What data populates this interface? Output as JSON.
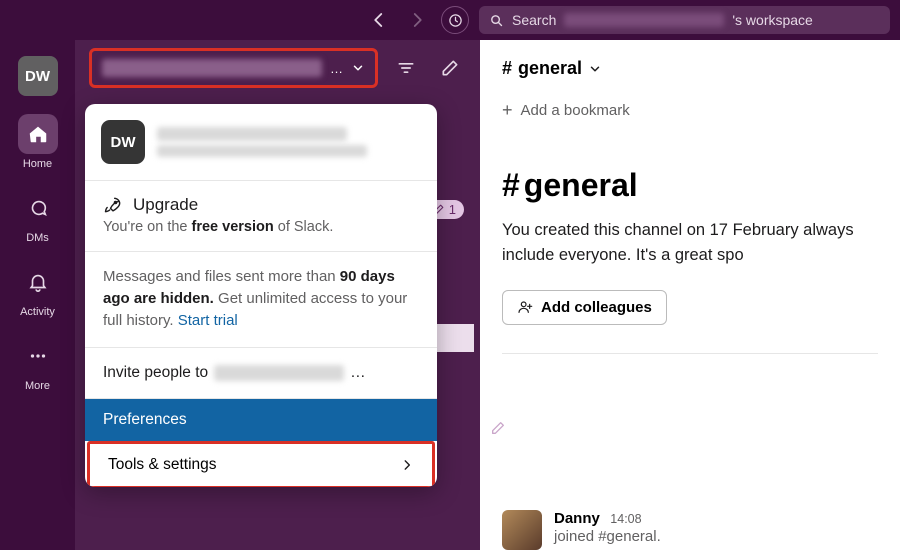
{
  "workspace_initials": "DW",
  "search": {
    "label_prefix": "Search ",
    "label_suffix": "'s workspace"
  },
  "rail": {
    "home": "Home",
    "dms": "DMs",
    "activity": "Activity",
    "more": "More"
  },
  "ws_header": {
    "caret_label": "v"
  },
  "draft_badge": {
    "count": "1"
  },
  "dropdown": {
    "badge_initials": "DW",
    "upgrade_title": "Upgrade",
    "upgrade_desc_pre": "You're on the ",
    "upgrade_desc_bold": "free version",
    "upgrade_desc_post": " of Slack.",
    "history_desc_pre": "Messages and files sent more than ",
    "history_desc_bold": "90 days ago are hidden.",
    "history_desc_post": " Get unlimited access to your full history. ",
    "start_trial": "Start trial",
    "invite_prefix": "Invite people to ",
    "invite_suffix": "…",
    "preferences": "Preferences",
    "tools_settings": "Tools & settings"
  },
  "channel": {
    "name": "general",
    "add_bookmark": "Add a bookmark",
    "desc": "You created this channel on 17 February always include everyone. It's a great spo",
    "add_colleagues": "Add colleagues"
  },
  "message": {
    "author": "Danny",
    "time": "14:08",
    "text": "joined #general."
  }
}
